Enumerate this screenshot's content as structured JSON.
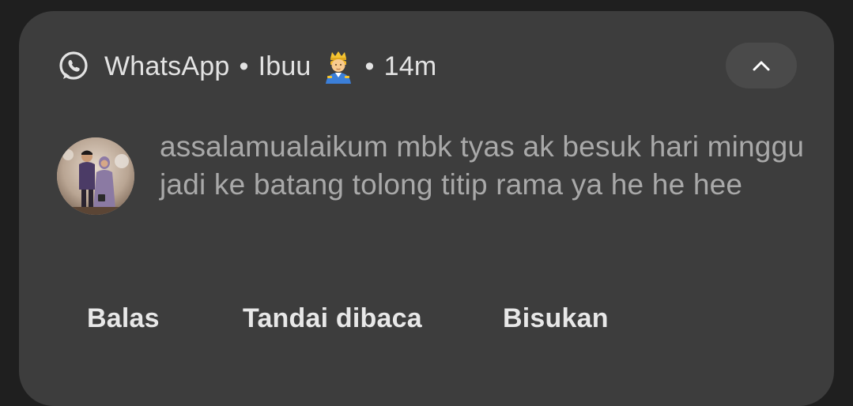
{
  "notification": {
    "app_name": "WhatsApp",
    "separator": "•",
    "sender": "Ibuu",
    "sender_emoji": "prince-emoji",
    "time": "14m",
    "expand_icon": "chevron-up-icon",
    "message": "assalamualaikum mbk tyas ak besuk hari minggu jadi ke batang tolong titip rama ya he he hee"
  },
  "actions": {
    "reply_label": "Balas",
    "mark_read_label": "Tandai dibaca",
    "mute_label": "Bisukan"
  },
  "colors": {
    "card_bg": "#3d3d3d",
    "page_bg": "#1f1f1f",
    "header_text": "#e3e3e3",
    "message_text": "#a9a9a9",
    "action_text": "#e8e8e8"
  }
}
